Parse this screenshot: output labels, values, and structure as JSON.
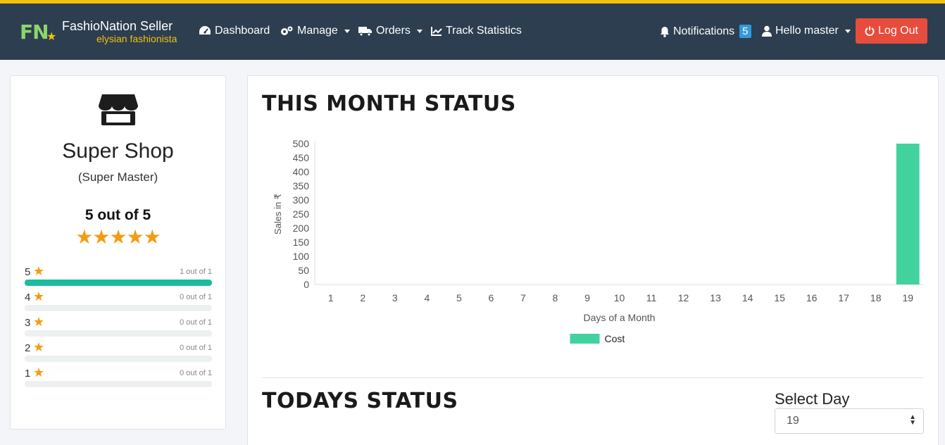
{
  "brand": {
    "logo": "FN",
    "name": "FashioNation Seller",
    "tagline": "elysian fashionista"
  },
  "nav": {
    "dashboard": "Dashboard",
    "manage": "Manage",
    "orders": "Orders",
    "track": "Track Statistics",
    "notifications": "Notifications",
    "notifications_count": "5",
    "user": "Hello master",
    "logout": "Log Out"
  },
  "shop": {
    "name": "Super Shop",
    "subtitle": "(Super Master)",
    "rating_title": "5 out of 5",
    "rating_stars": 5,
    "breakdown": [
      {
        "stars": "5",
        "count": "1 out of 1",
        "fraction": 1
      },
      {
        "stars": "4",
        "count": "0 out of 1",
        "fraction": 0
      },
      {
        "stars": "3",
        "count": "0 out of 1",
        "fraction": 0
      },
      {
        "stars": "2",
        "count": "0 out of 1",
        "fraction": 0
      },
      {
        "stars": "1",
        "count": "0 out of 1",
        "fraction": 0
      }
    ]
  },
  "main": {
    "month_title": "THIS MONTH STATUS",
    "today_title": "TODAYS STATUS",
    "select_label": "Select Day",
    "select_value": "19"
  },
  "chart_data": {
    "type": "bar",
    "categories": [
      "1",
      "2",
      "3",
      "4",
      "5",
      "6",
      "7",
      "8",
      "9",
      "10",
      "11",
      "12",
      "13",
      "14",
      "15",
      "16",
      "17",
      "18",
      "19"
    ],
    "series": [
      {
        "name": "Cost",
        "values": [
          0,
          0,
          0,
          0,
          0,
          0,
          0,
          0,
          0,
          0,
          0,
          0,
          0,
          0,
          0,
          0,
          0,
          0,
          500
        ],
        "color": "#42d29d"
      }
    ],
    "xlabel": "Days of a Month",
    "ylabel": "Sales in ₹",
    "ylim": [
      0,
      500
    ],
    "yticks": [
      0,
      50,
      100,
      150,
      200,
      250,
      300,
      350,
      400,
      450,
      500
    ],
    "legend": "bottom",
    "grid": false
  }
}
